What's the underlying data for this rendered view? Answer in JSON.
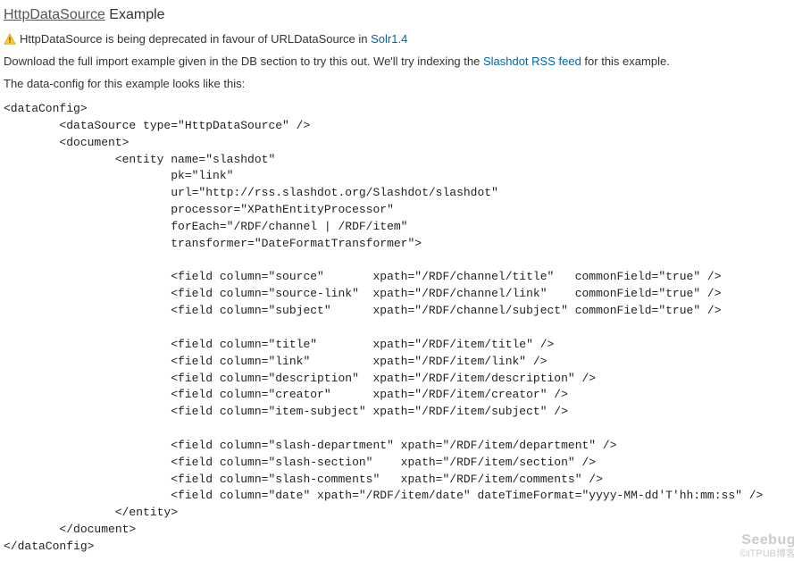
{
  "heading": {
    "link_text": "HttpDataSource",
    "suffix": " Example"
  },
  "warning": {
    "text_before": "HttpDataSource is being deprecated in favour of URLDataSource in ",
    "link_text": "Solr1.4"
  },
  "para1": {
    "before": "Download the full import example given in the DB section to try this out. We'll try indexing the ",
    "link_text": "Slashdot RSS feed",
    "after": " for this example."
  },
  "para2": "The data-config for this example looks like this:",
  "codeblock": "<dataConfig>\n        <dataSource type=\"HttpDataSource\" />\n        <document>\n                <entity name=\"slashdot\"\n                        pk=\"link\"\n                        url=\"http://rss.slashdot.org/Slashdot/slashdot\"\n                        processor=\"XPathEntityProcessor\"\n                        forEach=\"/RDF/channel | /RDF/item\"\n                        transformer=\"DateFormatTransformer\">\n\n                        <field column=\"source\"       xpath=\"/RDF/channel/title\"   commonField=\"true\" />\n                        <field column=\"source-link\"  xpath=\"/RDF/channel/link\"    commonField=\"true\" />\n                        <field column=\"subject\"      xpath=\"/RDF/channel/subject\" commonField=\"true\" />\n\n                        <field column=\"title\"        xpath=\"/RDF/item/title\" />\n                        <field column=\"link\"         xpath=\"/RDF/item/link\" />\n                        <field column=\"description\"  xpath=\"/RDF/item/description\" />\n                        <field column=\"creator\"      xpath=\"/RDF/item/creator\" />\n                        <field column=\"item-subject\" xpath=\"/RDF/item/subject\" />\n\n                        <field column=\"slash-department\" xpath=\"/RDF/item/department\" />\n                        <field column=\"slash-section\"    xpath=\"/RDF/item/section\" />\n                        <field column=\"slash-comments\"   xpath=\"/RDF/item/comments\" />\n                        <field column=\"date\" xpath=\"/RDF/item/date\" dateTimeFormat=\"yyyy-MM-dd'T'hh:mm:ss\" />\n                </entity>\n        </document>\n</dataConfig>",
  "watermark": {
    "line1": "Seebug",
    "line2": "©ITPUB博客"
  }
}
